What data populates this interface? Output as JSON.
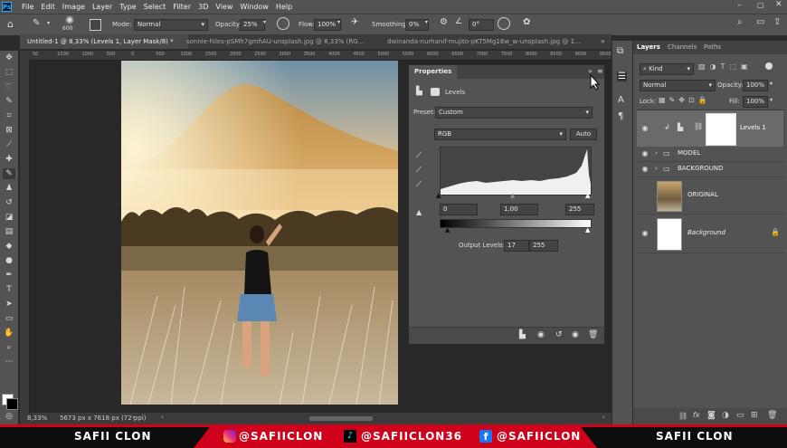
{
  "app": {
    "logo": "Ps"
  },
  "menu": [
    "File",
    "Edit",
    "Image",
    "Layer",
    "Type",
    "Select",
    "Filter",
    "3D",
    "View",
    "Window",
    "Help"
  ],
  "options": {
    "brush_size": "600",
    "mode_label": "Mode:",
    "mode_value": "Normal",
    "opacity_label": "Opacity:",
    "opacity_value": "25%",
    "flow_label": "Flow:",
    "flow_value": "100%",
    "smoothing_label": "Smoothing:",
    "smoothing_value": "0%",
    "angle_value": "0°"
  },
  "tabs": [
    {
      "label": "Untitled-1 @ 8,33% (Levels 1, Layer Mask/8) *"
    },
    {
      "label": "sonnie-hiles-pSMh7gmhAU-unsplash.jpg @ 8,33% (RG..."
    },
    {
      "label": "dwinanda-nurhanif-mujito-pKT5Mg16w_w-unsplash.jpg @ 1..."
    }
  ],
  "ruler_ticks": [
    "50",
    "1500",
    "1000",
    "500",
    "0",
    "500",
    "1000",
    "1500",
    "2000",
    "2500",
    "3000",
    "3500",
    "4000",
    "4500",
    "5000",
    "5500",
    "6000",
    "6500",
    "7000",
    "7500",
    "8000",
    "8500",
    "9000",
    "9500"
  ],
  "status": {
    "zoom": "8,33%",
    "dimensions": "5673 px x 7618 px (72 ppi)"
  },
  "properties": {
    "title": "Properties",
    "panel_name": "Levels",
    "preset_label": "Preset:",
    "preset_value": "Custom",
    "channel": "RGB",
    "auto_label": "Auto",
    "input_black": "0",
    "input_gamma": "1,00",
    "input_white": "255",
    "output_label": "Output Levels:",
    "output_black": "17",
    "output_white": "255"
  },
  "layers_panel": {
    "tabs": [
      "Layers",
      "Channels",
      "Paths"
    ],
    "kind_label": "Kind",
    "blend_mode": "Normal",
    "opacity_label": "Opacity:",
    "opacity_value": "100%",
    "lock_label": "Lock:",
    "fill_label": "Fill:",
    "fill_value": "100%",
    "items": [
      {
        "name": "Levels 1"
      },
      {
        "name": "MODEL"
      },
      {
        "name": "BACKGROUND"
      },
      {
        "name": "ORIGINAL"
      },
      {
        "name": "Background"
      }
    ]
  },
  "banner": {
    "left": "SAFII CLON",
    "instagram": "@SAFIICLON",
    "tiktok": "@SAFIICLON36",
    "facebook": "@SAFIICLON",
    "right": "SAFII CLON"
  },
  "colors": {
    "accent": "#31a8ff",
    "banner_red": "#d0021b",
    "panel": "#535353"
  }
}
